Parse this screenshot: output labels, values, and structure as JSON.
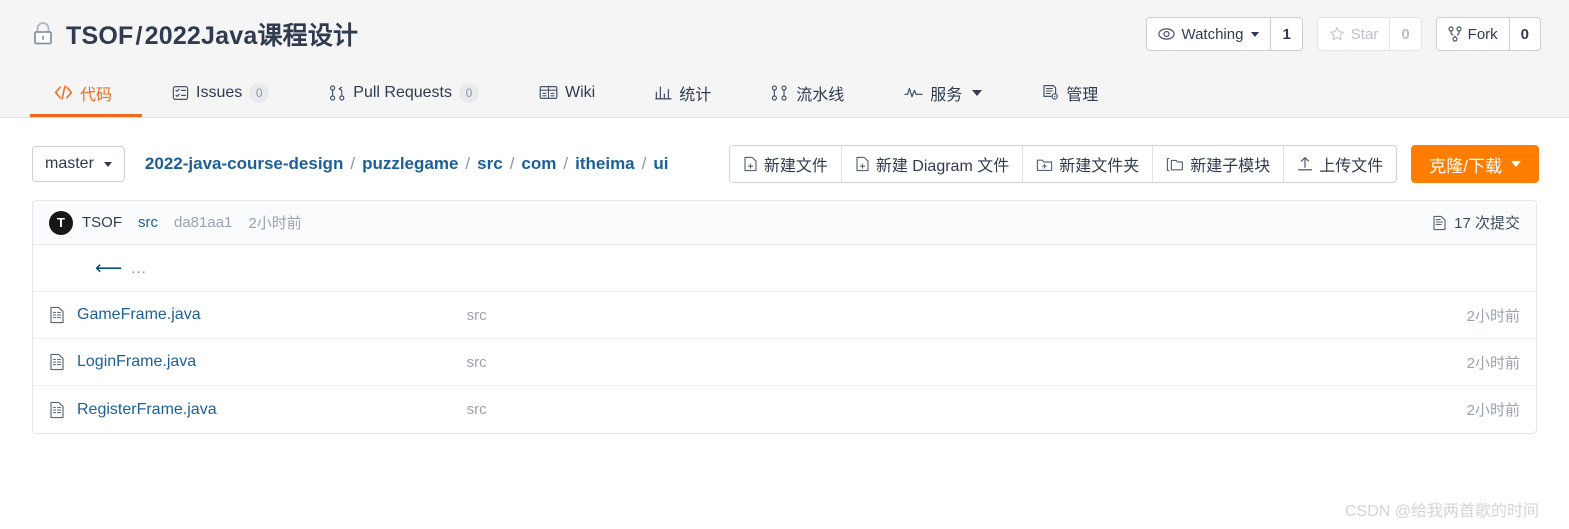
{
  "header": {
    "lock_icon": "lock-icon",
    "repo_owner": "TSOF",
    "separator": "/",
    "repo_name": "2022Java课程设计",
    "actions": [
      {
        "icon": "eye-icon",
        "label": "Watching",
        "count": "1",
        "has_caret": true,
        "disabled": false
      },
      {
        "icon": "star-icon",
        "label": "Star",
        "count": "0",
        "has_caret": false,
        "disabled": true
      },
      {
        "icon": "fork-icon",
        "label": "Fork",
        "count": "0",
        "has_caret": false,
        "disabled": false
      }
    ]
  },
  "nav": {
    "tabs": [
      {
        "icon": "code-icon",
        "label": "代码",
        "badge": "",
        "active": true,
        "caret": false
      },
      {
        "icon": "issues-icon",
        "label": "Issues",
        "badge": "0",
        "active": false,
        "caret": false
      },
      {
        "icon": "pull-request-icon",
        "label": "Pull Requests",
        "badge": "0",
        "active": false,
        "caret": false
      },
      {
        "icon": "wiki-icon",
        "label": "Wiki",
        "badge": "",
        "active": false,
        "caret": false
      },
      {
        "icon": "chart-icon",
        "label": "统计",
        "badge": "",
        "active": false,
        "caret": false
      },
      {
        "icon": "pipeline-icon",
        "label": "流水线",
        "badge": "",
        "active": false,
        "caret": false
      },
      {
        "icon": "service-icon",
        "label": "服务",
        "badge": "",
        "active": false,
        "caret": true
      },
      {
        "icon": "manage-icon",
        "label": "管理",
        "badge": "",
        "active": false,
        "caret": false
      }
    ]
  },
  "toolbar": {
    "branch": "master",
    "breadcrumb": [
      {
        "label": "2022-java-course-design",
        "link": true
      },
      {
        "label": "puzzlegame",
        "link": true
      },
      {
        "label": "src",
        "link": true
      },
      {
        "label": "com",
        "link": true
      },
      {
        "label": "itheima",
        "link": true
      },
      {
        "label": "ui",
        "link": true
      }
    ],
    "breadcrumb_sep": "/",
    "buttons": [
      {
        "icon": "new-file-icon",
        "label": "新建文件"
      },
      {
        "icon": "new-diagram-icon",
        "label": "新建 Diagram 文件"
      },
      {
        "icon": "new-folder-icon",
        "label": "新建文件夹"
      },
      {
        "icon": "new-submodule-icon",
        "label": "新建子模块"
      },
      {
        "icon": "upload-icon",
        "label": "上传文件"
      }
    ],
    "clone_label": "克隆/下载"
  },
  "commit_bar": {
    "avatar_letter": "T",
    "author": "TSOF",
    "message": "src",
    "sha": "da81aa1",
    "time": "2小时前",
    "commit_count_icon": "commit-history-icon",
    "commit_count": "17 次提交"
  },
  "file_list": {
    "parent_dir": {
      "icon": "back-arrow-icon",
      "label": "..."
    },
    "rows": [
      {
        "icon": "file-icon",
        "name": "GameFrame.java",
        "commit": "src",
        "time": "2小时前"
      },
      {
        "icon": "file-icon",
        "name": "LoginFrame.java",
        "commit": "src",
        "time": "2小时前"
      },
      {
        "icon": "file-icon",
        "name": "RegisterFrame.java",
        "commit": "src",
        "time": "2小时前"
      }
    ]
  },
  "watermark": {
    "text": "CSDN @给我两首歌的时间"
  },
  "colors": {
    "accent_orange": "#ff7d00",
    "active_tab": "#f26a1b",
    "link_blue": "#1c5f99",
    "text_dark": "#303b50",
    "muted": "#9aa2b0",
    "header_bg": "#f5f5f5"
  }
}
